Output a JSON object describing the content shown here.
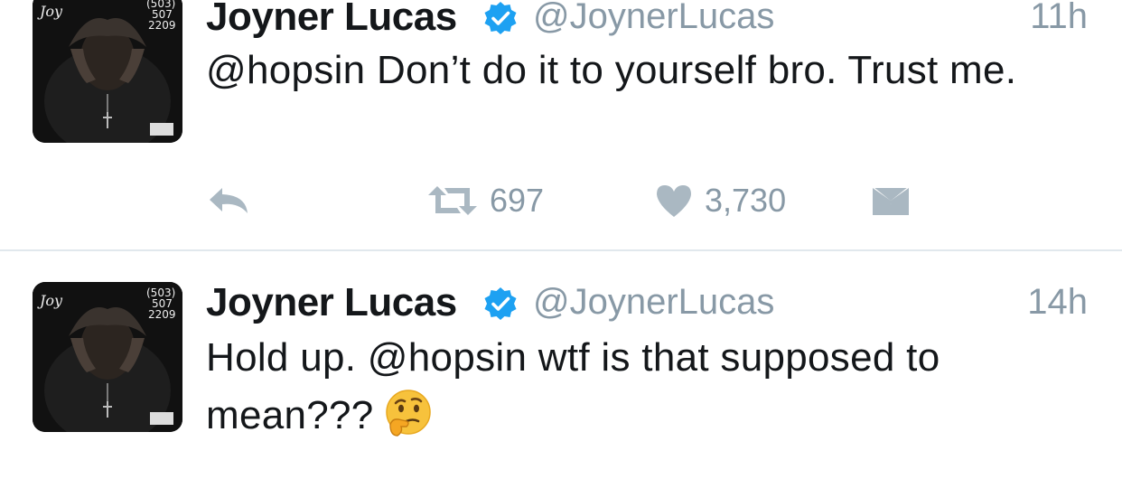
{
  "tweets": [
    {
      "name": "Joyner Lucas",
      "handle": "@JoynerLucas",
      "time": "11h",
      "text": "@hopsin Don’t do it to yourself bro. Trust me.",
      "retweets": "697",
      "likes": "3,730"
    },
    {
      "name": "Joyner Lucas",
      "handle": "@JoynerLucas",
      "time": "14h",
      "text": "Hold up. @hopsin wtf is that supposed to mean???",
      "emoji": "thinking-face"
    }
  ],
  "avatar_text": [
    "(503)",
    "507",
    "2209"
  ],
  "colors": {
    "name": "#14171a",
    "meta": "#8899a6",
    "verified": "#1da1f2",
    "divider": "#e1e8ed",
    "icon": "#aab8c2"
  }
}
